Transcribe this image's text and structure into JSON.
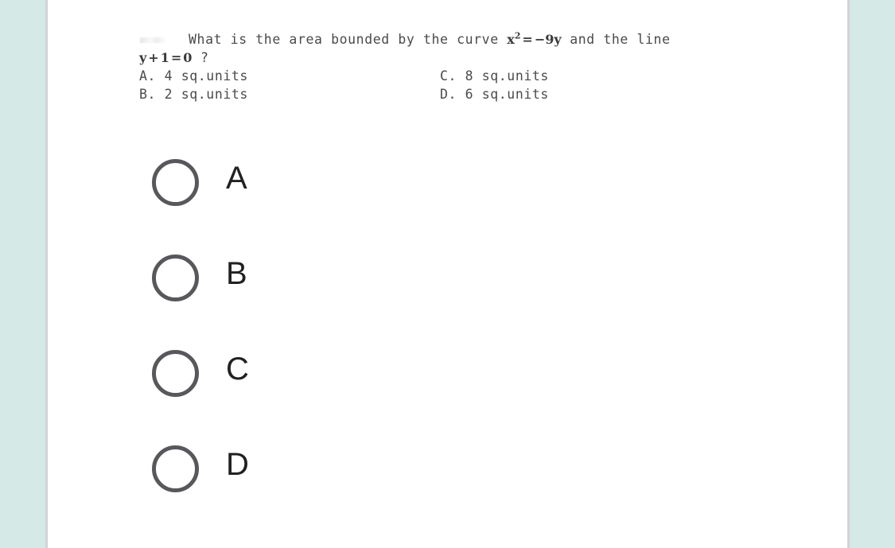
{
  "colors": {
    "side_panel_bg": "#d5e9e6",
    "card_bg": "#ffffff",
    "divider": "#d2d4d4",
    "radio_stroke": "#57585c",
    "option_text": "#212121",
    "scan_text": "#4a4a4a"
  },
  "question": {
    "line1_prefix": "What is the area bounded by the curve ",
    "equation1": {
      "base": "x",
      "exponent": "2",
      "operator": "=",
      "right": "−9y"
    },
    "line1_suffix": " and the line",
    "equation2": {
      "term1": "y",
      "plus": "+",
      "term2": "1",
      "operator": "=",
      "right": "0"
    },
    "line2_suffix": "?"
  },
  "answer_key": {
    "column_left": [
      {
        "letter": "A.",
        "value": "4 sq.units"
      },
      {
        "letter": "B.",
        "value": "2 sq.units"
      }
    ],
    "column_right": [
      {
        "letter": "C.",
        "value": "8 sq.units"
      },
      {
        "letter": "D.",
        "value": "6 sq.units"
      }
    ]
  },
  "options": [
    {
      "label": "A",
      "selected": false
    },
    {
      "label": "B",
      "selected": false
    },
    {
      "label": "C",
      "selected": false
    },
    {
      "label": "D",
      "selected": false
    }
  ]
}
